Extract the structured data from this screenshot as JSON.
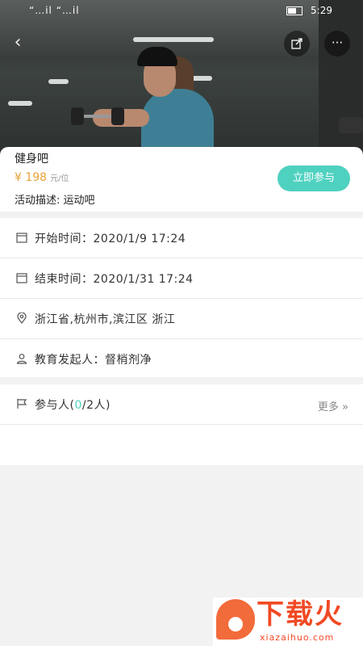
{
  "status_bar": {
    "signal_left": "“…il “…il",
    "time": "5:29"
  },
  "activity": {
    "title": "健身吧",
    "price": "¥ 198",
    "price_unit": "元/位",
    "description": "活动描述: 运动吧",
    "join_label": "立即参与"
  },
  "details": {
    "start": "开始时间：2020/1/9 17:24",
    "end": "结束时间：2020/1/31 17:24",
    "location": "浙江省,杭州市,滨江区 浙江",
    "organizer": "教育发起人：督梢剂净"
  },
  "participants": {
    "label_prefix": "参与人(",
    "count": "0",
    "label_suffix": "/2人)",
    "more": "更多 »"
  },
  "watermark": {
    "cn": "下载火",
    "en": "xiazaihuo.com"
  },
  "colors": {
    "accent": "#4fd1c0",
    "price": "#e7a23a",
    "brand": "#f04a24"
  }
}
